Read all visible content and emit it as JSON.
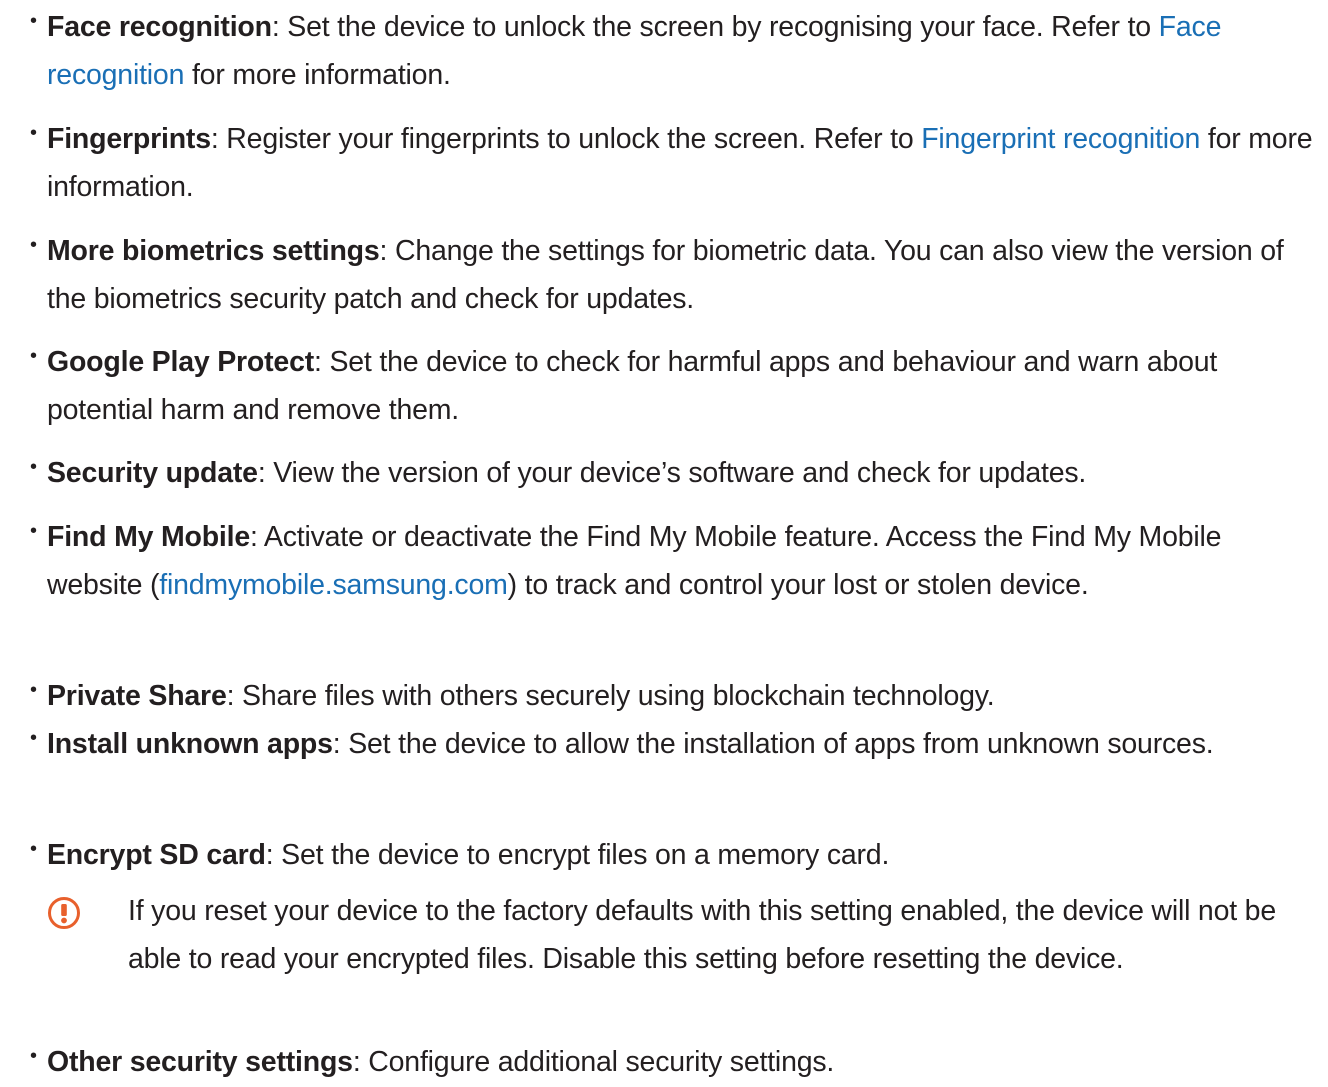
{
  "items": [
    {
      "term": "Face recognition",
      "text1": ": Set the device to unlock the screen by recognising your face. Refer to ",
      "link": "Face recognition",
      "text2": " for more information."
    },
    {
      "term": "Fingerprints",
      "text1": ": Register your fingerprints to unlock the screen. Refer to ",
      "link": "Fingerprint recognition",
      "text2": " for more information."
    },
    {
      "term": "More biometrics settings",
      "text1": ": Change the settings for biometric data. You can also view the version of the biometrics security patch and check for updates."
    },
    {
      "term": "Google Play Protect",
      "text1": ": Set the device to check for harmful apps and behaviour and warn about potential harm and remove them."
    },
    {
      "term": "Security update",
      "text1": ": View the version of your device’s software and check for updates."
    },
    {
      "term": "Find My Mobile",
      "text1": ": Activate or deactivate the Find My Mobile feature. Access the Find My Mobile website (",
      "link": "findmymobile.samsung.com",
      "text2": ") to track and control your lost or stolen device."
    },
    {
      "term": "Private Share",
      "text1": ": Share files with others securely using blockchain technology."
    },
    {
      "term": "Install unknown apps",
      "text1": ": Set the device to allow the installation of apps from unknown sources."
    },
    {
      "term": "Encrypt SD card",
      "text1": ": Set the device to encrypt files on a memory card."
    },
    {
      "term": "Other security settings",
      "text1": ": Configure additional security settings."
    }
  ],
  "bullet": "•",
  "note": {
    "icon": "caution-icon",
    "icon_color": "#e8602c",
    "text": "If you reset your device to the factory defaults with this setting enabled, the device will not be able to read your encrypted files. Disable this setting before resetting the device."
  },
  "colors": {
    "text": "#231f20",
    "link": "#1a6fb5"
  }
}
